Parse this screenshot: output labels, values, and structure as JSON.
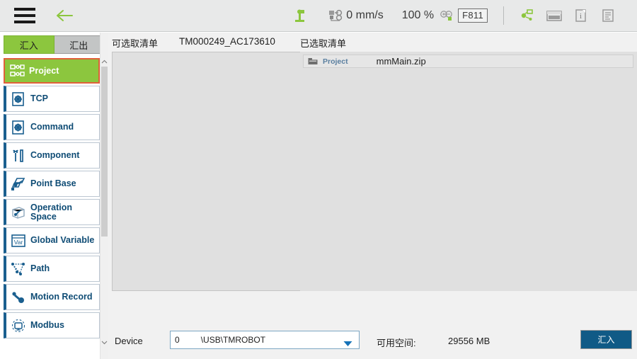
{
  "toolbar": {
    "menu_icon": "hamburger-menu-icon",
    "back_icon": "back-arrow-icon",
    "robot_icon": "robot-arm-icon",
    "speed_icon": "speed-gauge-icon",
    "speed_value": "0 mm/s",
    "percent_value": "100 %",
    "zoom_icon": "zoom-in-out-icon",
    "function_key": "F811",
    "network_icon": "network-node-icon",
    "keyboard_icon": "keyboard-icon",
    "info_icon": "info-icon",
    "log_icon": "log-list-icon",
    "accent_green": "#8cc63e",
    "bg": "#e8e9e9"
  },
  "sidebar": {
    "tabs": [
      {
        "label": "汇入",
        "active": true,
        "name": "tab-import"
      },
      {
        "label": "汇出",
        "active": false,
        "name": "tab-export"
      }
    ],
    "items": [
      {
        "label": "Project",
        "icon": "project-node-icon",
        "selected": true
      },
      {
        "label": "TCP",
        "icon": "gear-document-icon",
        "selected": false
      },
      {
        "label": "Command",
        "icon": "gear-document-icon",
        "selected": false
      },
      {
        "label": "Component",
        "icon": "wrench-tools-icon",
        "selected": false
      },
      {
        "label": "Point Base",
        "icon": "point-base-icon",
        "selected": false
      },
      {
        "label": "Operation\nSpace",
        "icon": "operation-space-icon",
        "selected": false
      },
      {
        "label": "Global Variable",
        "icon": "variable-icon",
        "selected": false
      },
      {
        "label": "Path",
        "icon": "path-nodes-icon",
        "selected": false
      },
      {
        "label": "Motion Record",
        "icon": "motion-record-icon",
        "selected": false
      },
      {
        "label": "Modbus",
        "icon": "modbus-icon",
        "selected": false
      }
    ],
    "selected_border": "#e0603a",
    "selected_bg": "#8cc63e",
    "item_accent": "#1a5f8f"
  },
  "main": {
    "available_list_title": "可选取清单",
    "source_name": "TM000249_AC173610",
    "selected_list_title": "已选取清单",
    "selected_files": [
      {
        "type": "Project",
        "name": "mmMain.zip",
        "icon": "folder-icon"
      }
    ],
    "available_files": []
  },
  "bottom": {
    "device_label": "Device",
    "device_index": "0",
    "device_path": "\\USB\\TMROBOT",
    "caret_icon": "chevron-down-icon",
    "space_label": "可用空间:",
    "space_value": "29556 MB",
    "import_button": "汇入",
    "import_button_color": "#105a86"
  }
}
